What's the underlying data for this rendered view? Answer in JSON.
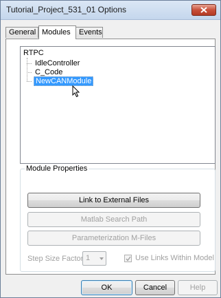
{
  "window": {
    "title": "Tutorial_Project_531_01 Options",
    "close_icon": "close-icon",
    "close_color": "#c8503a"
  },
  "tabs": [
    {
      "label": "General",
      "selected": false
    },
    {
      "label": "Modules",
      "selected": true
    },
    {
      "label": "Events",
      "selected": false
    }
  ],
  "tree": {
    "root": "RTPC",
    "items": [
      {
        "label": "IdleController",
        "selected": false
      },
      {
        "label": "C_Code",
        "selected": false
      },
      {
        "label": "NewCANModule",
        "selected": true
      }
    ],
    "selection_color": "#3399ff"
  },
  "module_properties": {
    "legend": "Module Properties",
    "link_button": "Link to External Files",
    "matlab_button": "Matlab Search Path",
    "param_button": "Parameterization M-Files",
    "step_size_label": "Step Size Factor",
    "step_size_value": "1",
    "use_links_label": "Use Links Within Model",
    "use_links_checked": true
  },
  "footer": {
    "ok": "OK",
    "cancel": "Cancel",
    "help": "Help"
  }
}
